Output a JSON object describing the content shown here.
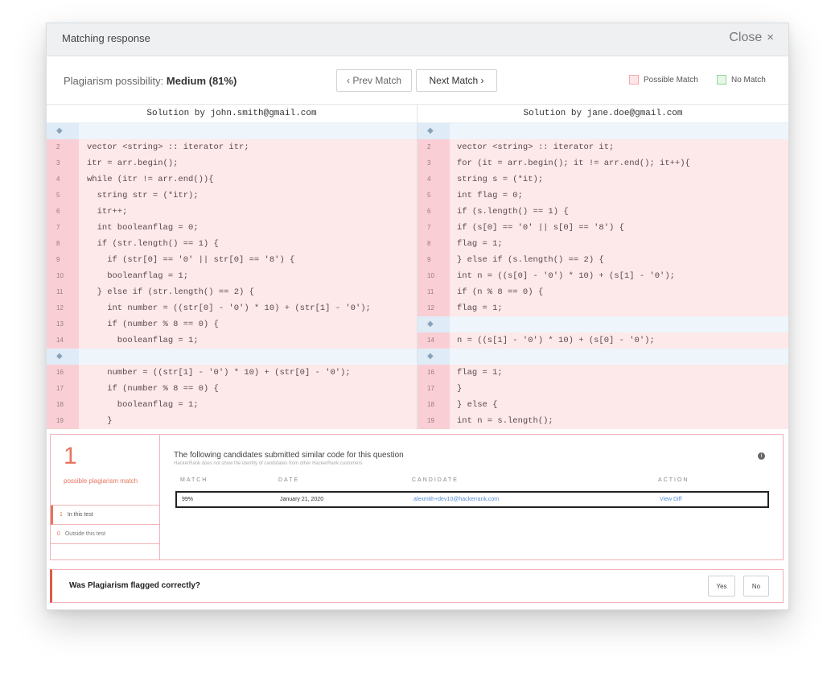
{
  "header": {
    "title": "Matching response",
    "close_label": "Close",
    "close_icon": "×"
  },
  "toolbar": {
    "possibility_label": "Plagiarism possibility:",
    "possibility_value": "Medium (81%)",
    "prev_label": "‹ Prev Match",
    "next_label": "Next Match ›",
    "legend_possible": "Possible Match",
    "legend_no": "No Match"
  },
  "left": {
    "title": "Solution by john.smith@gmail.com",
    "rows": [
      {
        "n": "◆",
        "t": "",
        "k": "sep"
      },
      {
        "n": "2",
        "t": "vector <string> :: iterator itr;",
        "k": "match"
      },
      {
        "n": "3",
        "t": "itr = arr.begin();",
        "k": "match"
      },
      {
        "n": "4",
        "t": "while (itr != arr.end()){",
        "k": "match"
      },
      {
        "n": "5",
        "t": "  string str = (*itr);",
        "k": "match"
      },
      {
        "n": "6",
        "t": "  itr++;",
        "k": "match"
      },
      {
        "n": "7",
        "t": "  int booleanflag = 0;",
        "k": "match"
      },
      {
        "n": "8",
        "t": "  if (str.length() == 1) {",
        "k": "match"
      },
      {
        "n": "9",
        "t": "    if (str[0] == '0' || str[0] == '8') {",
        "k": "match"
      },
      {
        "n": "10",
        "t": "    booleanflag = 1;",
        "k": "match"
      },
      {
        "n": "11",
        "t": "  } else if (str.length() == 2) {",
        "k": "match"
      },
      {
        "n": "12",
        "t": "    int number = ((str[0] - '0') * 10) + (str[1] - '0');",
        "k": "match"
      },
      {
        "n": "13",
        "t": "    if (number % 8 == 0) {",
        "k": "match"
      },
      {
        "n": "14",
        "t": "      booleanflag = 1;",
        "k": "match"
      },
      {
        "n": "◆",
        "t": "",
        "k": "sep"
      },
      {
        "n": "16",
        "t": "    number = ((str[1] - '0') * 10) + (str[0] - '0');",
        "k": "match"
      },
      {
        "n": "17",
        "t": "    if (number % 8 == 0) {",
        "k": "match"
      },
      {
        "n": "18",
        "t": "      booleanflag = 1;",
        "k": "match"
      },
      {
        "n": "19",
        "t": "    }",
        "k": "match"
      }
    ]
  },
  "right": {
    "title": "Solution by jane.doe@gmail.com",
    "rows": [
      {
        "n": "◆",
        "t": "",
        "k": "sep"
      },
      {
        "n": "2",
        "t": "vector <string> :: iterator it;",
        "k": "match"
      },
      {
        "n": "3",
        "t": "for (it = arr.begin(); it != arr.end(); it++){",
        "k": "match"
      },
      {
        "n": "4",
        "t": "string s = (*it);",
        "k": "match"
      },
      {
        "n": "5",
        "t": "int flag = 0;",
        "k": "match"
      },
      {
        "n": "6",
        "t": "if (s.length() == 1) {",
        "k": "match"
      },
      {
        "n": "7",
        "t": "if (s[0] == '0' || s[0] == '8') {",
        "k": "match"
      },
      {
        "n": "8",
        "t": "flag = 1;",
        "k": "match"
      },
      {
        "n": "9",
        "t": "} else if (s.length() == 2) {",
        "k": "match"
      },
      {
        "n": "10",
        "t": "int n = ((s[0] - '0') * 10) + (s[1] - '0');",
        "k": "match"
      },
      {
        "n": "11",
        "t": "if (n % 8 == 0) {",
        "k": "match"
      },
      {
        "n": "12",
        "t": "flag = 1;",
        "k": "match"
      },
      {
        "n": "◆",
        "t": "",
        "k": "sep"
      },
      {
        "n": "14",
        "t": "n = ((s[1] - '0') * 10) + (s[0] - '0');",
        "k": "match"
      },
      {
        "n": "◆",
        "t": "",
        "k": "sep"
      },
      {
        "n": "16",
        "t": "flag = 1;",
        "k": "match"
      },
      {
        "n": "17",
        "t": "}",
        "k": "match"
      },
      {
        "n": "18",
        "t": "} else {",
        "k": "match"
      },
      {
        "n": "19",
        "t": "int n = s.length();",
        "k": "match"
      }
    ]
  },
  "summary": {
    "count": "1",
    "count_label": "possible plagiarism match",
    "in_test_count": "1",
    "in_test_label": "In this test",
    "out_test_count": "0",
    "out_test_label": "Outside this test"
  },
  "candidates": {
    "heading": "The following candidates submitted similar code for this question",
    "sub": "HackerRank does not show the identity of candidates from other HackerRank customers",
    "info_icon": "i",
    "columns": [
      "MATCH",
      "DATE",
      "CANDIDATE",
      "ACTION"
    ],
    "row": {
      "match": "99%",
      "date": "January 21, 2020",
      "candidate": "alexmith+dev10@hackerrank.com",
      "action": "View Diff"
    }
  },
  "feedback": {
    "question": "Was Plagiarism flagged correctly?",
    "yes": "Yes",
    "no": "No"
  }
}
